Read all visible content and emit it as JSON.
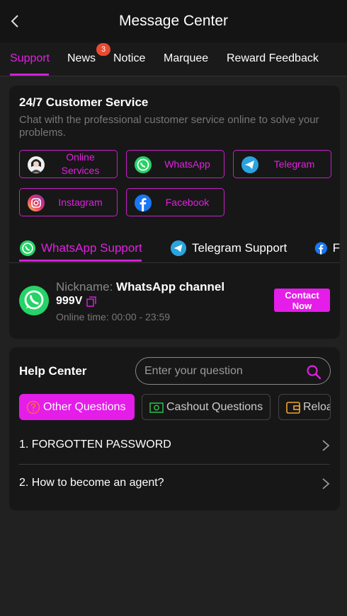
{
  "header": {
    "title": "Message Center"
  },
  "tabs": [
    {
      "label": "Support",
      "active": true
    },
    {
      "label": "News",
      "badge": "3"
    },
    {
      "label": "Notice"
    },
    {
      "label": "Marquee"
    },
    {
      "label": "Reward Feedback"
    }
  ],
  "customer_service": {
    "title": "24/7 Customer Service",
    "description": "Chat with the professional customer service online to solve your problems.",
    "channels": [
      {
        "label": "Online Services",
        "icon": "avatar-icon"
      },
      {
        "label": "WhatsApp",
        "icon": "whatsapp-icon"
      },
      {
        "label": "Telegram",
        "icon": "telegram-icon"
      },
      {
        "label": "Instagram",
        "icon": "instagram-icon"
      },
      {
        "label": "Facebook",
        "icon": "facebook-icon"
      }
    ],
    "support_tabs": [
      {
        "label": "WhatsApp Support",
        "active": true,
        "icon": "whatsapp-icon"
      },
      {
        "label": "Telegram Support",
        "icon": "telegram-icon"
      },
      {
        "label": "F",
        "icon": "facebook-icon"
      }
    ],
    "contact": {
      "nickname_label": "Nickname:",
      "nickname": "WhatsApp channel",
      "handle": "999V",
      "online_time": "Online time: 00:00 - 23:59",
      "button": "Contact Now"
    }
  },
  "help_center": {
    "title": "Help Center",
    "search_placeholder": "Enter your question",
    "categories": [
      {
        "label": "Other Questions",
        "active": true,
        "icon": "question-icon"
      },
      {
        "label": "Cashout Questions",
        "icon": "cash-icon"
      },
      {
        "label": "Reloa",
        "icon": "wallet-icon"
      }
    ],
    "faq": [
      {
        "label": "1. FORGOTTEN PASSWORD"
      },
      {
        "label": "2. How to become an agent?"
      }
    ]
  },
  "colors": {
    "accent": "#e41de8",
    "background": "#212121",
    "card": "#171717",
    "badge": "#e84a32",
    "whatsapp": "#25d366",
    "telegram": "#2aa3df",
    "facebook": "#1877f2"
  }
}
